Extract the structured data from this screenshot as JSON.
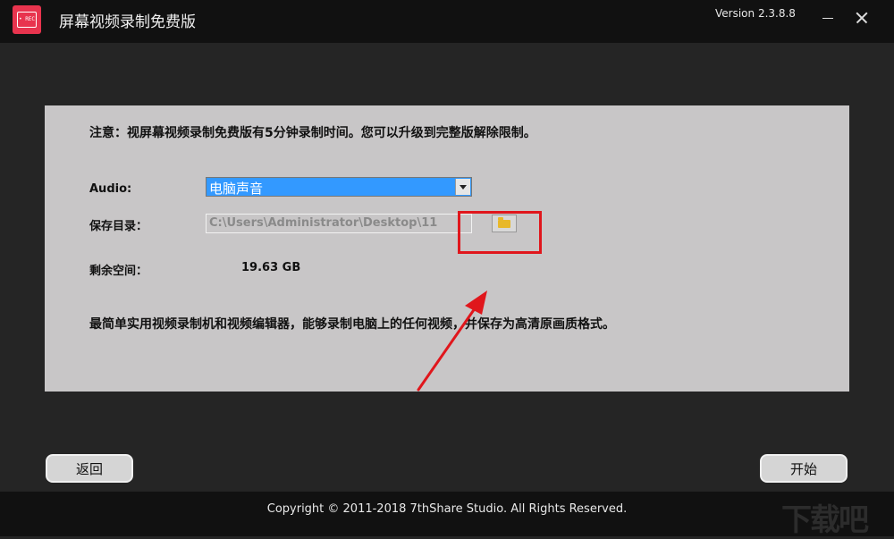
{
  "window": {
    "title": "屏幕视频录制免费版",
    "version": "Version 2.3.8.8",
    "logo_text": "• REC"
  },
  "panel": {
    "notice": "注意：视屏幕视频录制免费版有5分钟录制时间。您可以升级到完整版解除限制。",
    "audio_label": "Audio:",
    "audio_value": "电脑声音",
    "save_label": "保存目录：",
    "save_path": "C:\\Users\\Administrator\\Desktop\\11",
    "space_label": "剩余空间：",
    "space_value": "19.63 GB",
    "description": "最简单实用视频录制机和视频编辑器，能够录制电脑上的任何视频，并保存为高清原画质格式。"
  },
  "buttons": {
    "back": "返回",
    "start": "开始"
  },
  "footer": {
    "copyright": "Copyright © 2011-2018 7thShare Studio. All Rights Reserved.",
    "watermark": "下载吧"
  },
  "colors": {
    "accent_logo": "#e8344e",
    "select_highlight": "#3399ff",
    "annotation": "#e0161c",
    "folder": "#e8b82a"
  }
}
